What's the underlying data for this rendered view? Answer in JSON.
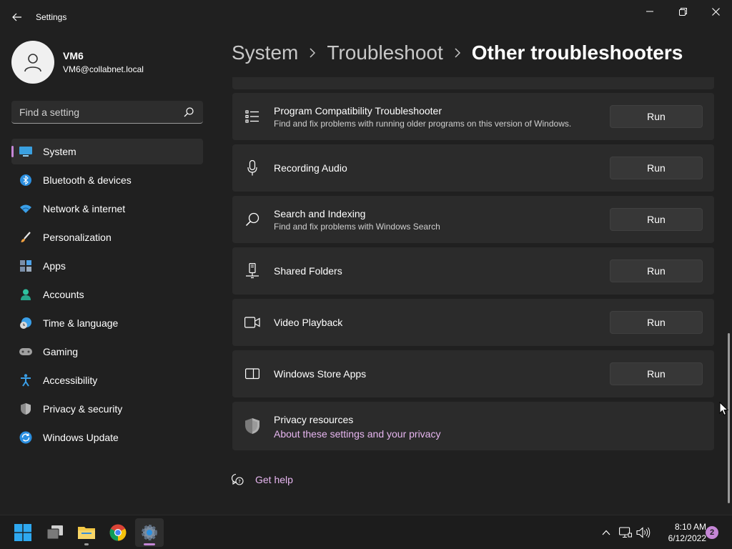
{
  "window": {
    "title": "Settings",
    "controls": [
      "minimize",
      "maximize",
      "close"
    ]
  },
  "profile": {
    "name": "VM6",
    "email": "VM6@collabnet.local"
  },
  "search": {
    "placeholder": "Find a setting",
    "value": ""
  },
  "sidebar": {
    "items": [
      {
        "label": "System",
        "icon": "system-icon",
        "selected": true
      },
      {
        "label": "Bluetooth & devices",
        "icon": "bluetooth-icon",
        "selected": false
      },
      {
        "label": "Network & internet",
        "icon": "wifi-icon",
        "selected": false
      },
      {
        "label": "Personalization",
        "icon": "brush-icon",
        "selected": false
      },
      {
        "label": "Apps",
        "icon": "apps-icon",
        "selected": false
      },
      {
        "label": "Accounts",
        "icon": "person-icon",
        "selected": false
      },
      {
        "label": "Time & language",
        "icon": "clock-globe-icon",
        "selected": false
      },
      {
        "label": "Gaming",
        "icon": "gamepad-icon",
        "selected": false
      },
      {
        "label": "Accessibility",
        "icon": "accessibility-icon",
        "selected": false
      },
      {
        "label": "Privacy & security",
        "icon": "shield-icon",
        "selected": false
      },
      {
        "label": "Windows Update",
        "icon": "update-icon",
        "selected": false
      }
    ],
    "accent_color": "#c586d6"
  },
  "breadcrumb": {
    "items": [
      "System",
      "Troubleshoot"
    ],
    "current": "Other troubleshooters"
  },
  "troubleshooters": [
    {
      "title": "Program Compatibility Troubleshooter",
      "description": "Find and fix problems with running older programs on this version of Windows.",
      "icon": "list-icon",
      "button": "Run"
    },
    {
      "title": "Recording Audio",
      "description": "",
      "icon": "microphone-icon",
      "button": "Run"
    },
    {
      "title": "Search and Indexing",
      "description": "Find and fix problems with Windows Search",
      "icon": "search-icon",
      "button": "Run"
    },
    {
      "title": "Shared Folders",
      "description": "",
      "icon": "network-drive-icon",
      "button": "Run"
    },
    {
      "title": "Video Playback",
      "description": "",
      "icon": "video-camera-icon",
      "button": "Run"
    },
    {
      "title": "Windows Store Apps",
      "description": "",
      "icon": "window-panel-icon",
      "button": "Run"
    }
  ],
  "privacy": {
    "title": "Privacy resources",
    "link": "About these settings and your privacy",
    "icon": "shield-icon"
  },
  "get_help": {
    "label": "Get help",
    "icon": "help-chat-icon"
  },
  "taskbar": {
    "apps": [
      {
        "name": "start",
        "icon": "windows-logo-icon"
      },
      {
        "name": "task-view",
        "icon": "task-view-icon"
      },
      {
        "name": "file-explorer",
        "icon": "folder-icon"
      },
      {
        "name": "chrome",
        "icon": "chrome-icon"
      },
      {
        "name": "settings",
        "icon": "gear-icon",
        "active": true
      }
    ],
    "tray": [
      "chevron-up-icon",
      "network-icon",
      "volume-icon"
    ],
    "time": "8:10 AM",
    "date": "6/12/2022",
    "notification_count": "2"
  },
  "colors": {
    "background": "#202020",
    "card": "#2b2b2b",
    "link": "#e7b6f0",
    "accent": "#c586d6"
  }
}
